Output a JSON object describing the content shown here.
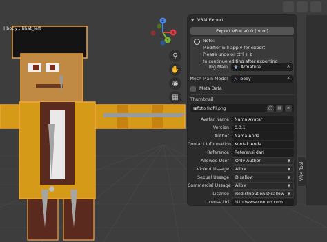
{
  "viewport": {
    "object_label": "| body : lihat_left",
    "gizmo_axes": {
      "x": "X",
      "y": "Y",
      "z": "Z"
    }
  },
  "panel": {
    "header": "VRM Export",
    "export_button": "Export VRM v0.0 (.vrm)",
    "note_title": "Note:",
    "note_lines": [
      "Modifier will apply for export",
      "Please undo or ctrl + z",
      "to continue editing after exporting"
    ],
    "rig_main_label": "Rig Main",
    "rig_main_value": "Armature",
    "mesh_main_label": "Mesh Main Model",
    "mesh_main_value": "body",
    "meta_data_label": "Meta Data",
    "thumbnail_label": "Thumbnail",
    "thumbnail_file": "foto frofil.png",
    "fields": [
      {
        "label": "Avatar Name",
        "value": "Nama Avatar",
        "type": "text"
      },
      {
        "label": "Version",
        "value": "0.0.1",
        "type": "text"
      },
      {
        "label": "Author",
        "value": "Nama Anda",
        "type": "text"
      },
      {
        "label": "Contact Information",
        "value": "Kontak Anda",
        "type": "text"
      },
      {
        "label": "Reference",
        "value": "Referensi dari",
        "type": "text"
      },
      {
        "label": "Allowed User",
        "value": "Only Author",
        "type": "dropdown"
      },
      {
        "label": "Violent Ussage",
        "value": "Allow",
        "type": "dropdown"
      },
      {
        "label": "Sexual Ussage",
        "value": "Disallow",
        "type": "dropdown"
      },
      {
        "label": "Commercial Ussage",
        "value": "Allow",
        "type": "dropdown"
      },
      {
        "label": "License",
        "value": "Redistribution Disallow",
        "type": "dropdown"
      },
      {
        "label": "License Url",
        "value": "http:\\www.contoh.com",
        "type": "text"
      }
    ],
    "side_tab": "VRM Tool"
  },
  "icons": {
    "zoom": "zoom-icon",
    "pan": "hand-icon",
    "camera": "camera-icon",
    "grid": "grid-icon",
    "armature": "armature-icon",
    "mesh": "mesh-icon",
    "info": "info-icon",
    "folder": "folder-icon"
  },
  "colors": {
    "selection_outline": "#f2a53a",
    "panel_bg": "#2b2b2b",
    "field_bg": "#1e1e1e",
    "viewport_bg": "#3d3d3d"
  }
}
